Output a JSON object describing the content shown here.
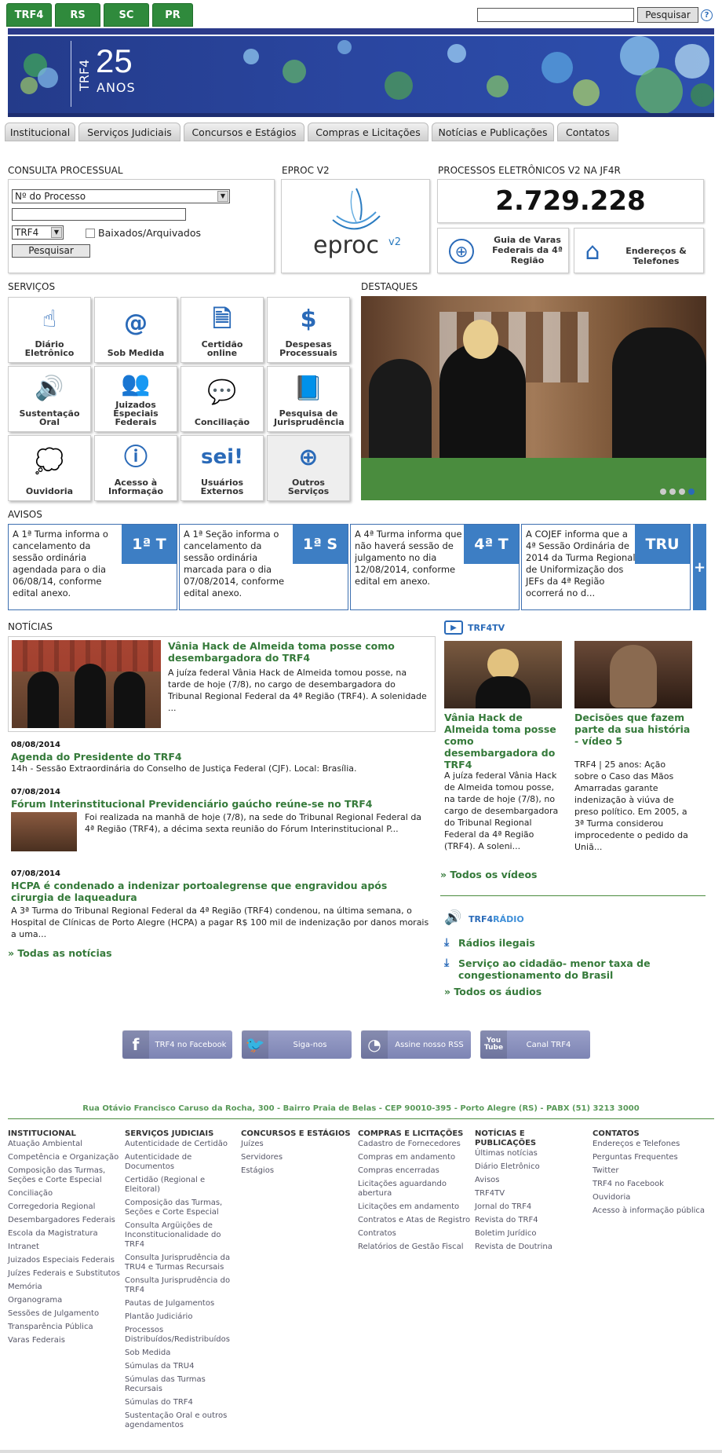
{
  "top_tabs": [
    "TRF4",
    "RS",
    "SC",
    "PR"
  ],
  "search": {
    "button": "Pesquisar",
    "help": "?"
  },
  "banner": {
    "logo_small": "TRF4",
    "logo_big": "25",
    "logo_sub": "ANOS"
  },
  "nav": [
    "Institucional",
    "Serviços Judiciais",
    "Concursos e Estágios",
    "Compras e Licitações",
    "Notícias e Publicações",
    "Contatos"
  ],
  "consulta": {
    "title": "CONSULTA PROCESSUAL",
    "select_type": "Nº do Processo",
    "select_org": "TRF4",
    "checkbox_label": "Baixados/Arquivados",
    "button": "Pesquisar"
  },
  "eproc": {
    "title": "EPROC V2",
    "logo_text": "eproc",
    "logo_version": "v2"
  },
  "processos": {
    "title": "PROCESSOS ELETRÔNICOS V2 NA JF4R",
    "count": "2.729.228",
    "guia": "Guia de Varas Federais da 4ª Região",
    "enderecos": "Endereços & Telefones"
  },
  "servicos": {
    "title": "SERVIÇOS",
    "tiles": [
      {
        "label": "Diário Eletrônico",
        "icon": "☝"
      },
      {
        "label": "Sob Medida",
        "icon": "@"
      },
      {
        "label": "Certidão online",
        "icon": "🗎"
      },
      {
        "label": "Despesas Processuais",
        "icon": "$"
      },
      {
        "label": "Sustentação Oral",
        "icon": "🔊"
      },
      {
        "label": "Juizados Especiais Federais",
        "icon": "👥"
      },
      {
        "label": "Conciliação",
        "icon": "💬"
      },
      {
        "label": "Pesquisa de Jurisprudência",
        "icon": "📘"
      },
      {
        "label": "Ouvidoria",
        "icon": "💭"
      },
      {
        "label": "Acesso à Informação",
        "icon": "ⓘ"
      },
      {
        "label": "Usuários Externos",
        "icon": "sei!"
      },
      {
        "label": "Outros Serviços",
        "icon": "⊕"
      }
    ]
  },
  "destaques": {
    "title": "DESTAQUES"
  },
  "avisos": {
    "title": "AVISOS",
    "items": [
      {
        "text": "A 1ª Turma informa o cancelamento da sessão ordinária agendada para o dia 06/08/14, conforme edital anexo.",
        "badge": "1ª T"
      },
      {
        "text": "A 1ª Seção informa o cancelamento da sessão ordinária marcada para o dia 07/08/2014, conforme edital anexo.",
        "badge": "1ª S"
      },
      {
        "text": "A 4ª Turma informa que não haverá sessão de julgamento no dia 12/08/2014, conforme edital em anexo.",
        "badge": "4ª T"
      },
      {
        "text": "A COJEF informa que a 4ª Sessão Ordinária de 2014 da Turma Regional de Uniformização dos JEFs da 4ª Região ocorrerá no d...",
        "badge": "TRU"
      }
    ],
    "more": "+"
  },
  "noticias": {
    "title": "NOTÍCIAS",
    "featured": {
      "title": "Vânia Hack de Almeida toma posse como desembargadora do TRF4",
      "text": "A juíza federal Vânia Hack de Almeida tomou posse, na tarde de hoje (7/8), no cargo de desembargadora do Tribunal Regional Federal da 4ª Região (TRF4). A solenidade ..."
    },
    "items": [
      {
        "date": "08/08/2014",
        "title": "Agenda do Presidente do TRF4",
        "text": "14h - Sessão Extraordinária do Conselho de Justiça Federal (CJF). Local: Brasília."
      },
      {
        "date": "07/08/2014",
        "title": "Fórum Interinstitucional Previdenciário gaúcho reúne-se no TRF4",
        "text": "Foi realizada na manhã de hoje (7/8), na sede do Tribunal Regional Federal da 4ª Região (TRF4), a décima sexta reunião do Fórum Interinstitucional P..."
      },
      {
        "date": "07/08/2014",
        "title": "HCPA é condenado a indenizar portoalegrense que engravidou após cirurgia de laqueadura",
        "text": "A 3ª Turma do Tribunal Regional Federal da 4ª Região (TRF4) condenou, na última semana, o Hospital de Clínicas de Porto Alegre (HCPA) a pagar R$ 100 mil de indenização por danos morais a uma..."
      }
    ],
    "all": "» Todas as notícias"
  },
  "tv": {
    "logo": "TRF4TV",
    "videos": [
      {
        "title": "Vânia Hack de Almeida toma posse como desembargadora do TRF4",
        "text": "A juíza federal Vânia Hack de Almeida tomou posse, na tarde de hoje (7/8), no cargo de desembargadora do Tribunal Regional Federal da 4ª Região (TRF4). A soleni..."
      },
      {
        "title": "Decisões que fazem parte da sua história - vídeo 5",
        "text": "TRF4 | 25 anos: Ação sobre o Caso das Mãos Amarradas garante indenização à viúva de preso político. Em 2005, a 3ª Turma considerou improcedente o pedido da Uniã..."
      }
    ],
    "all": "» Todos os vídeos"
  },
  "radio": {
    "logo_a": "TRF4",
    "logo_b": "RÁDIO",
    "items": [
      "Rádios ilegais",
      "Serviço ao cidadão- menor taxa de congestionamento do Brasil"
    ],
    "all": "» Todos os áudios"
  },
  "social": [
    {
      "icon": "f",
      "label": "TRF4 no Facebook"
    },
    {
      "icon": "🐦",
      "label": "Siga-nos"
    },
    {
      "icon": "◔",
      "label": "Assine nosso RSS"
    },
    {
      "icon": "You Tube",
      "label": "Canal TRF4"
    }
  ],
  "address": "Rua Otávio Francisco Caruso da Rocha, 300 - Bairro Praia de Belas - CEP 90010-395 - Porto Alegre (RS) - PABX (51) 3213 3000",
  "footer": [
    {
      "title": "INSTITUCIONAL",
      "items": [
        "Atuação Ambiental",
        "Competência e Organização",
        "Composição das Turmas, Seções e Corte Especial",
        "Conciliação",
        "Corregedoria Regional",
        "Desembargadores Federais",
        "Escola da Magistratura",
        "Intranet",
        "Juizados Especiais Federais",
        "Juízes Federais e Substitutos",
        "Memória",
        "Organograma",
        "Sessões de Julgamento",
        "Transparência Pública",
        "Varas Federais"
      ]
    },
    {
      "title": "SERVIÇOS JUDICIAIS",
      "items": [
        "Autenticidade de Certidão",
        "Autenticidade de Documentos",
        "Certidão (Regional e Eleitoral)",
        "Composição das Turmas, Seções e Corte Especial",
        "Consulta Argüições de Inconstitucionalidade do TRF4",
        "Consulta Jurisprudência da TRU4 e Turmas Recursais",
        "Consulta Jurisprudência do TRF4",
        "Pautas de Julgamentos",
        "Plantão Judiciário",
        "Processos Distribuídos/Redistribuídos",
        "Sob Medida",
        "Súmulas da TRU4",
        "Súmulas das Turmas Recursais",
        "Súmulas do TRF4",
        "Sustentação Oral e outros agendamentos"
      ]
    },
    {
      "title": "CONCURSOS E ESTÁGIOS",
      "items": [
        "Juízes",
        "Servidores",
        "Estágios"
      ]
    },
    {
      "title": "COMPRAS E LICITAÇÕES",
      "items": [
        "Cadastro de Fornecedores",
        "Compras em andamento",
        "Compras encerradas",
        "Licitações aguardando abertura",
        "Licitações em andamento",
        "Contratos e Atas de Registro",
        "Contratos",
        "Relatórios de Gestão Fiscal"
      ]
    },
    {
      "title": "NOTÍCIAS E PUBLICAÇÕES",
      "items": [
        "Últimas notícias",
        "Diário Eletrônico",
        "Avisos",
        "TRF4TV",
        "Jornal do TRF4",
        "Revista do TRF4",
        "Boletim Jurídico",
        "Revista de Doutrina"
      ]
    },
    {
      "title": "CONTATOS",
      "items": [
        "Endereços e Telefones",
        "Perguntas Frequentes",
        "Twitter",
        "TRF4 no Facebook",
        "Ouvidoria",
        "Acesso à informação pública"
      ]
    }
  ]
}
